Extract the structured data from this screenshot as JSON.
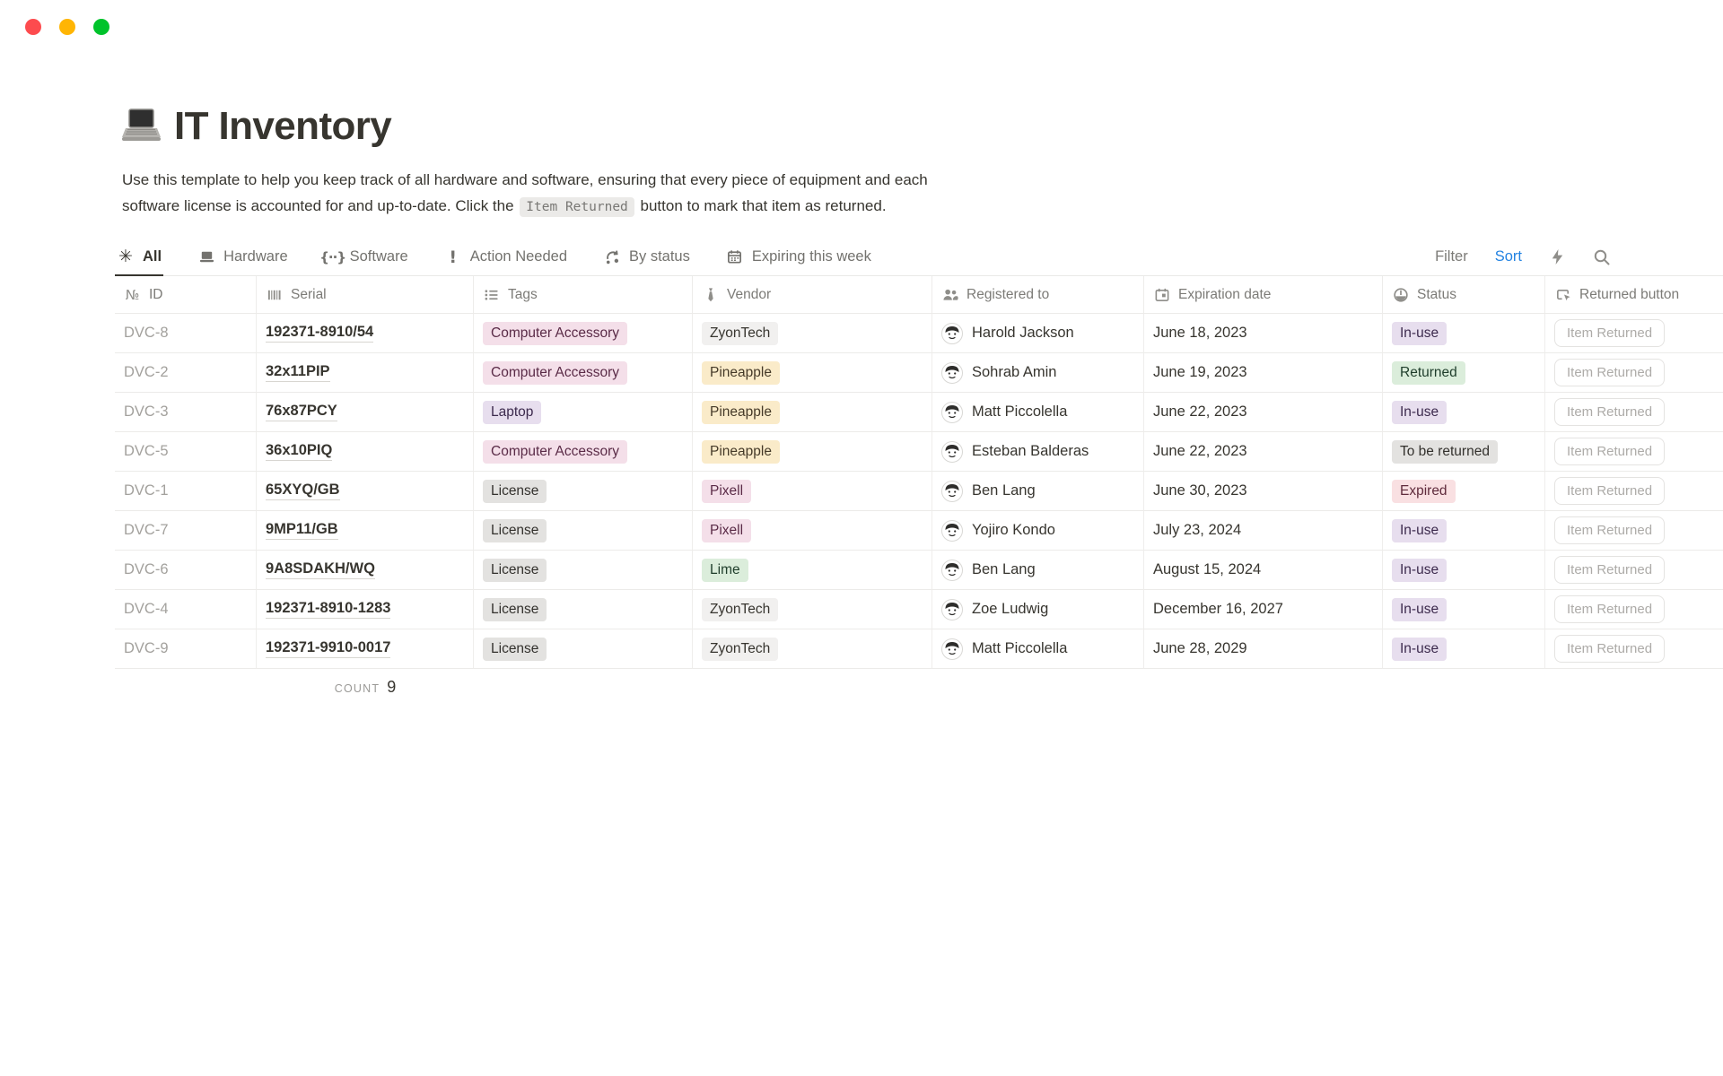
{
  "window": {
    "traffic_light_colors": [
      "#FD4B4E",
      "#FFB504",
      "#00C32B"
    ]
  },
  "page": {
    "emoji": "laptop",
    "title": "IT Inventory",
    "description": {
      "line1": "Use this template to help you keep track of all hardware and software, ensuring that every piece of equipment and each",
      "line2_before": "software license is accounted for and up-to-date. Click the ",
      "code": "Item Returned",
      "line2_after": " button to mark that item as returned."
    }
  },
  "tabs": [
    {
      "label": "All",
      "icon": "asterisk-icon",
      "active": true
    },
    {
      "label": "Hardware",
      "icon": "laptop-icon",
      "active": false
    },
    {
      "label": "Software",
      "icon": "braces-icon",
      "active": false
    },
    {
      "label": "Action Needed",
      "icon": "exclamation-icon",
      "active": false
    },
    {
      "label": "By status",
      "icon": "cycle-icon",
      "active": false
    },
    {
      "label": "Expiring this week",
      "icon": "calendar-icon",
      "active": false
    }
  ],
  "toolbar": {
    "filter_label": "Filter",
    "sort_label": "Sort",
    "sort_color": "#2383E2"
  },
  "table": {
    "columns": [
      {
        "label": "ID",
        "icon": "numero-icon"
      },
      {
        "label": "Serial",
        "icon": "barcode-icon"
      },
      {
        "label": "Tags",
        "icon": "list-icon"
      },
      {
        "label": "Vendor",
        "icon": "necktie-icon"
      },
      {
        "label": "Registered to",
        "icon": "people-icon"
      },
      {
        "label": "Expiration date",
        "icon": "calendar-icon"
      },
      {
        "label": "Status",
        "icon": "status-dial-icon"
      },
      {
        "label": "Returned button",
        "icon": "button-click-icon"
      }
    ],
    "returned_button_label": "Item Returned",
    "rows": [
      {
        "id": "DVC-8",
        "serial": "192371-8910/54",
        "tag": {
          "label": "Computer Accessory",
          "color": "pink"
        },
        "vendor": {
          "label": "ZyonTech",
          "color": "lightgray"
        },
        "person": "Harold Jackson",
        "date": "June 18, 2023",
        "status": {
          "label": "In-use",
          "color": "purple"
        }
      },
      {
        "id": "DVC-2",
        "serial": "32x11PIP",
        "tag": {
          "label": "Computer Accessory",
          "color": "pink"
        },
        "vendor": {
          "label": "Pineapple",
          "color": "yellow"
        },
        "person": "Sohrab Amin",
        "date": "June 19, 2023",
        "status": {
          "label": "Returned",
          "color": "green"
        }
      },
      {
        "id": "DVC-3",
        "serial": "76x87PCY",
        "tag": {
          "label": "Laptop",
          "color": "purple"
        },
        "vendor": {
          "label": "Pineapple",
          "color": "yellow"
        },
        "person": "Matt Piccolella",
        "date": "June 22, 2023",
        "status": {
          "label": "In-use",
          "color": "purple"
        }
      },
      {
        "id": "DVC-5",
        "serial": "36x10PIQ",
        "tag": {
          "label": "Computer Accessory",
          "color": "pink"
        },
        "vendor": {
          "label": "Pineapple",
          "color": "yellow"
        },
        "person": "Esteban Balderas",
        "date": "June 22, 2023",
        "status": {
          "label": "To be returned",
          "color": "gray"
        }
      },
      {
        "id": "DVC-1",
        "serial": "65XYQ/GB",
        "tag": {
          "label": "License",
          "color": "gray"
        },
        "vendor": {
          "label": "Pixell",
          "color": "pink"
        },
        "person": "Ben Lang",
        "date": "June 30, 2023",
        "status": {
          "label": "Expired",
          "color": "red"
        }
      },
      {
        "id": "DVC-7",
        "serial": "9MP11/GB",
        "tag": {
          "label": "License",
          "color": "gray"
        },
        "vendor": {
          "label": "Pixell",
          "color": "pink"
        },
        "person": "Yojiro Kondo",
        "date": "July 23, 2024",
        "status": {
          "label": "In-use",
          "color": "purple"
        }
      },
      {
        "id": "DVC-6",
        "serial": "9A8SDAKH/WQ",
        "tag": {
          "label": "License",
          "color": "gray"
        },
        "vendor": {
          "label": "Lime",
          "color": "green"
        },
        "person": "Ben Lang",
        "date": "August 15, 2024",
        "status": {
          "label": "In-use",
          "color": "purple"
        }
      },
      {
        "id": "DVC-4",
        "serial": "192371-8910-1283",
        "tag": {
          "label": "License",
          "color": "gray"
        },
        "vendor": {
          "label": "ZyonTech",
          "color": "lightgray"
        },
        "person": "Zoe Ludwig",
        "date": "December 16, 2027",
        "status": {
          "label": "In-use",
          "color": "purple"
        }
      },
      {
        "id": "DVC-9",
        "serial": "192371-9910-0017",
        "tag": {
          "label": "License",
          "color": "gray"
        },
        "vendor": {
          "label": "ZyonTech",
          "color": "lightgray"
        },
        "person": "Matt Piccolella",
        "date": "June 28, 2029",
        "status": {
          "label": "In-use",
          "color": "purple"
        }
      }
    ]
  },
  "colors": {
    "pink": {
      "bg": "#F4DFE9",
      "text": "#5A2B47"
    },
    "purple": {
      "bg": "#E7DEEE",
      "text": "#3C2A4D"
    },
    "yellow": {
      "bg": "#FAEBC9",
      "text": "#453A28"
    },
    "gray": {
      "bg": "#E3E2E0",
      "text": "#33312D"
    },
    "lightgray": {
      "bg": "#F1F0EF",
      "text": "#37352F"
    },
    "green": {
      "bg": "#DBEDDB",
      "text": "#1F3D2B"
    },
    "red": {
      "bg": "#F9E0E2",
      "text": "#5F2B3C"
    }
  },
  "footer": {
    "count_label": "COUNT",
    "count_value": "9"
  }
}
